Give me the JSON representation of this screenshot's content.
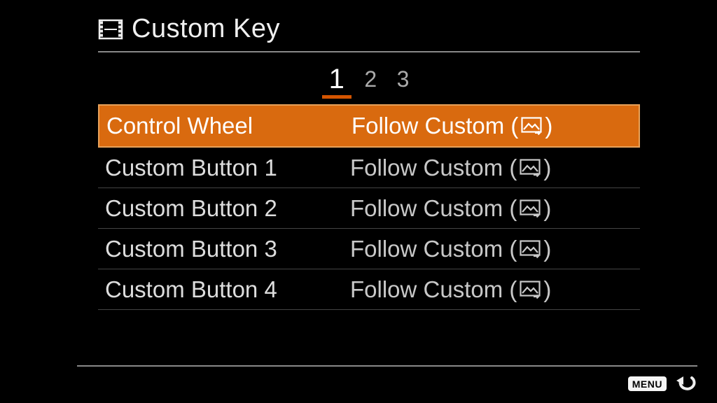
{
  "header": {
    "title": "Custom Key"
  },
  "pager": {
    "pages": [
      "1",
      "2",
      "3"
    ],
    "active_index": 0
  },
  "rows": [
    {
      "label": "Control Wheel",
      "value_prefix": "Follow Custom (",
      "value_suffix": ")",
      "selected": true
    },
    {
      "label": "Custom Button 1",
      "value_prefix": "Follow Custom (",
      "value_suffix": ")",
      "selected": false
    },
    {
      "label": "Custom Button 2",
      "value_prefix": "Follow Custom (",
      "value_suffix": ")",
      "selected": false
    },
    {
      "label": "Custom Button 3",
      "value_prefix": "Follow Custom (",
      "value_suffix": ")",
      "selected": false
    },
    {
      "label": "Custom Button 4",
      "value_prefix": "Follow Custom (",
      "value_suffix": ")",
      "selected": false
    }
  ],
  "footer": {
    "menu_label": "MENU"
  }
}
